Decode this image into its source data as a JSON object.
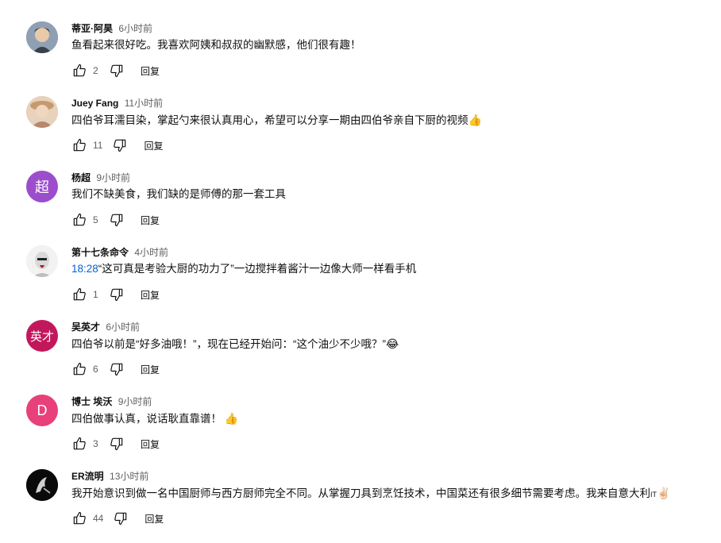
{
  "reply_label": "回复",
  "comments": [
    {
      "author": "蒂亚·阿昊",
      "time": "6小时前",
      "text": "鱼看起来很好吃。我喜欢阿姨和叔叔的幽默感，他们很有趣！",
      "likes": "2",
      "avatar": {
        "type": "photo",
        "color": "#6b7a8f"
      }
    },
    {
      "author": "Juey Fang",
      "time": "11小时前",
      "text": "四伯爷耳濡目染，掌起勺来很认真用心，希望可以分享一期由四伯爷亲自下厨的视频",
      "emoji": "👍",
      "likes": "11",
      "avatar": {
        "type": "photo",
        "color": "#d9b99b"
      }
    },
    {
      "author": "杨超",
      "time": "9小时前",
      "text": "我们不缺美食，我们缺的是师傅的那一套工具",
      "likes": "5",
      "avatar": {
        "type": "initial",
        "initial": "超",
        "color": "#9c4dcc"
      }
    },
    {
      "author": "第十七条命令",
      "time": "4小时前",
      "timestamp": "18:28",
      "text": "“这可真是考验大厨的功力了”一边搅拌着酱汁一边像大师一样看手机",
      "likes": "1",
      "avatar": {
        "type": "photo",
        "color": "#e8e8e8"
      }
    },
    {
      "author": "吴英才",
      "time": "6小时前",
      "text": "四伯爷以前是“好多油哦！”，现在已经开始问：“这个油少不少哦？”",
      "emoji": "😂",
      "likes": "6",
      "avatar": {
        "type": "initial",
        "initial": "英才",
        "color": "#c2185b"
      }
    },
    {
      "author": "博士 埃沃",
      "time": "9小时前",
      "text": "四伯做事认真，说话耿直靠谱！",
      "emoji": "👍",
      "likes": "3",
      "avatar": {
        "type": "initial",
        "initial": "D",
        "color": "#e8407a"
      }
    },
    {
      "author": "ER流明",
      "time": "13小时前",
      "text": "我开始意识到做一名中国厨师与西方厨师完全不同。从掌握刀具到烹饪技术，中国菜还有很多细节需要考虑。我来自意大利",
      "tag": "IT",
      "emoji": "✌🏻",
      "likes": "44",
      "avatar": {
        "type": "photo",
        "color": "#111111"
      }
    }
  ],
  "icons": {
    "like": "thumbs-up-icon",
    "dislike": "thumbs-down-icon"
  },
  "colors": {
    "text": "#0f0f0f",
    "secondary": "#606060",
    "link": "#065fd4"
  }
}
